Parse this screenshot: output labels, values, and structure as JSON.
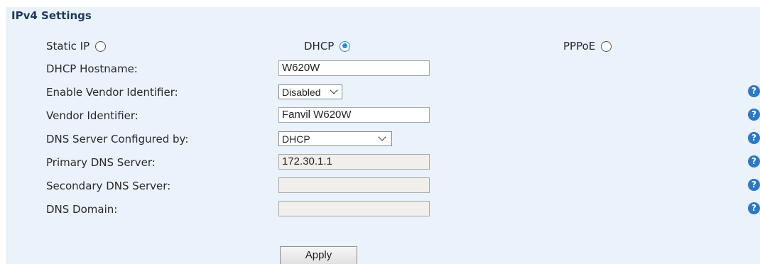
{
  "section": {
    "title": "IPv4 Settings"
  },
  "mode": {
    "static_ip_label": "Static IP",
    "dhcp_label": "DHCP",
    "pppoe_label": "PPPoE",
    "selected": "DHCP"
  },
  "fields": {
    "dhcp_hostname": {
      "label": "DHCP Hostname:",
      "value": "W620W"
    },
    "enable_vendor_identifier": {
      "label": "Enable Vendor Identifier:",
      "value": "Disabled"
    },
    "vendor_identifier": {
      "label": "Vendor Identifier:",
      "value": "Fanvil W620W"
    },
    "dns_server_configured_by": {
      "label": "DNS Server Configured by:",
      "value": "DHCP"
    },
    "primary_dns_server": {
      "label": "Primary DNS Server:",
      "value": "172.30.1.1"
    },
    "secondary_dns_server": {
      "label": "Secondary DNS Server:",
      "value": ""
    },
    "dns_domain": {
      "label": "DNS Domain:",
      "value": ""
    }
  },
  "help_icon": {
    "glyph": "?",
    "icon": "help-icon",
    "color": "#2b79c9"
  },
  "actions": {
    "apply_label": "Apply"
  },
  "colors": {
    "panel_bg": "#eaf2fb",
    "radio_selected": "#2a8be0"
  }
}
